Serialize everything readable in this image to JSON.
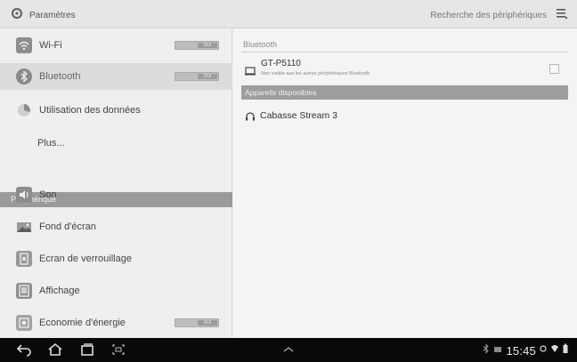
{
  "action_bar": {
    "title": "Paramètres",
    "scan_label": "Recherche des périphériques",
    "menu_icon": "overflow-menu-icon",
    "app_icon": "settings-gear-icon"
  },
  "sidebar": {
    "items": [
      {
        "label": "Wi-Fi",
        "icon": "wifi-icon",
        "toggle_text": "OUI"
      },
      {
        "label": "Bluetooth",
        "icon": "bluetooth-icon",
        "toggle_text": "OUI"
      },
      {
        "label": "Utilisation des données",
        "icon": "data-usage-icon"
      },
      {
        "label": "Plus..."
      },
      {
        "label": "Son",
        "icon": "sound-icon"
      },
      {
        "label": "Fond d'écran",
        "icon": "wallpaper-icon"
      },
      {
        "label": "Ecran de verrouillage",
        "icon": "lock-screen-icon"
      },
      {
        "label": "Affichage",
        "icon": "display-icon"
      },
      {
        "label": "Economie d'énergie",
        "icon": "power-saving-icon",
        "toggle_text": "OUI"
      }
    ],
    "section_header": "Périphérique"
  },
  "content": {
    "section_title": "Bluetooth",
    "device": {
      "name": "GT-P5110",
      "subtitle": "Non visible aux les autres périphériques Bluetooth",
      "icon": "tablet-icon"
    },
    "available_header": "Appareils disponibles",
    "available_devices": [
      {
        "name": "Cabasse Stream 3",
        "icon": "headphones-icon"
      }
    ]
  },
  "navbar": {
    "time": "15:45",
    "icons": [
      "back-icon",
      "home-icon",
      "recent-apps-icon",
      "screenshot-icon",
      "chevron-up-icon"
    ]
  }
}
